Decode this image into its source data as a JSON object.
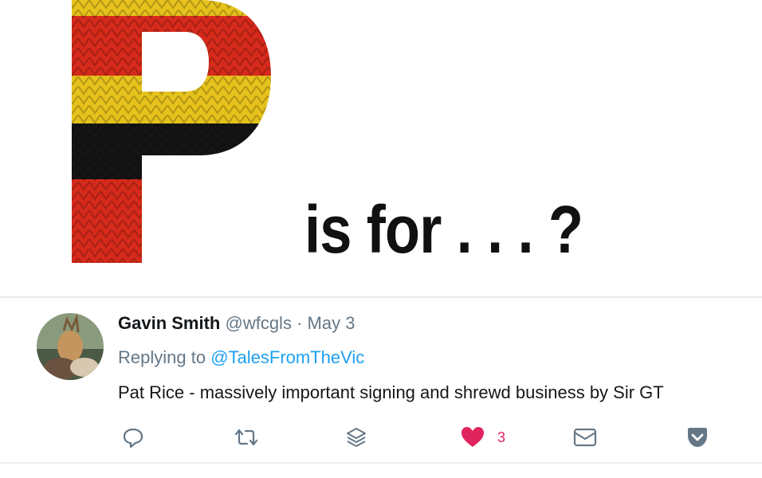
{
  "hero": {
    "letter": "P",
    "text": "is for . . . ?",
    "stripe_colors": {
      "red": "#d62a1a",
      "yellow": "#e6c21c",
      "black": "#141414"
    }
  },
  "tweet": {
    "display_name": "Gavin Smith",
    "handle": "@wfcgls",
    "separator": " · ",
    "date": "May 3",
    "replying_prefix": "Replying to ",
    "replying_to": "@TalesFromTheVic",
    "text": "Pat Rice - massively important signing and shrewd business by Sir GT",
    "avatar_icon": "avatar-photo",
    "actions": {
      "reply_icon": "reply-icon",
      "retweet_icon": "retweet-icon",
      "stack_icon": "stack-icon",
      "like_icon": "heart-icon",
      "like_count": "3",
      "message_icon": "mail-icon",
      "save_icon": "pocket-icon"
    },
    "colors": {
      "name": "#14171a",
      "meta": "#657786",
      "link": "#1da1f2",
      "like": "#e0245e",
      "divider": "#e6ecf0"
    }
  }
}
